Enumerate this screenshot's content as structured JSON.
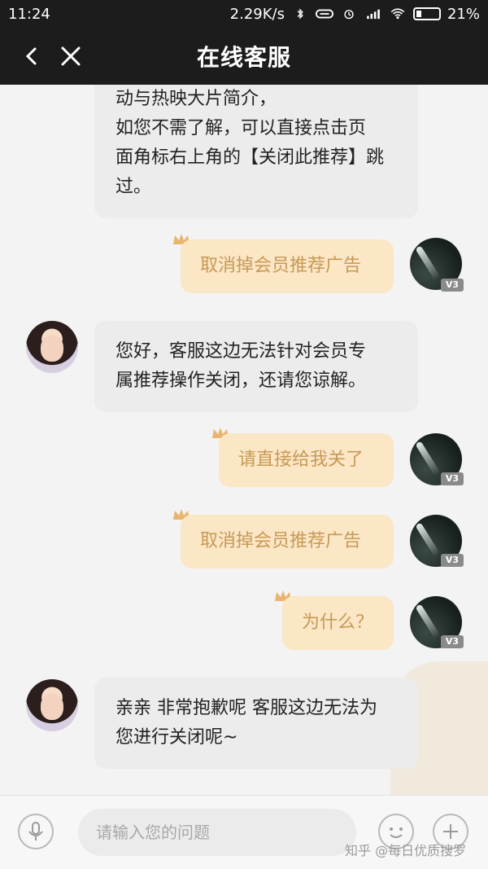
{
  "status_bar": {
    "time": "11:24",
    "net_speed": "2.29K/s",
    "battery_pct": "21%"
  },
  "nav": {
    "title": "在线客服"
  },
  "messages": [
    {
      "from": "agent",
      "lines": [
        "动与热映大片简介，",
        "如您不需了解，可以直接点击页",
        "面角标右上角的【关闭此推荐】跳",
        "过。"
      ]
    },
    {
      "from": "user",
      "text": "取消掉会员推荐广告",
      "badge": "V3"
    },
    {
      "from": "agent",
      "lines": [
        "您好，客服这边无法针对会员专",
        "属推荐操作关闭，还请您谅解。"
      ]
    },
    {
      "from": "user",
      "text": "请直接给我关了",
      "badge": "V3"
    },
    {
      "from": "user",
      "text": "取消掉会员推荐广告",
      "badge": "V3"
    },
    {
      "from": "user",
      "text": "为什么？",
      "badge": "V3"
    },
    {
      "from": "agent",
      "lines": [
        "亲亲 非常抱歉呢 客服这边无法为",
        "您进行关闭呢~"
      ]
    }
  ],
  "input": {
    "placeholder": "请输入您的问题"
  },
  "watermark": "知乎 @每日优质搜罗",
  "colors": {
    "header_bg": "#1c1c1c",
    "user_bubble_bg": "#fbe6c6",
    "user_bubble_text": "#c79a55",
    "agent_bubble_bg": "#ececec"
  }
}
